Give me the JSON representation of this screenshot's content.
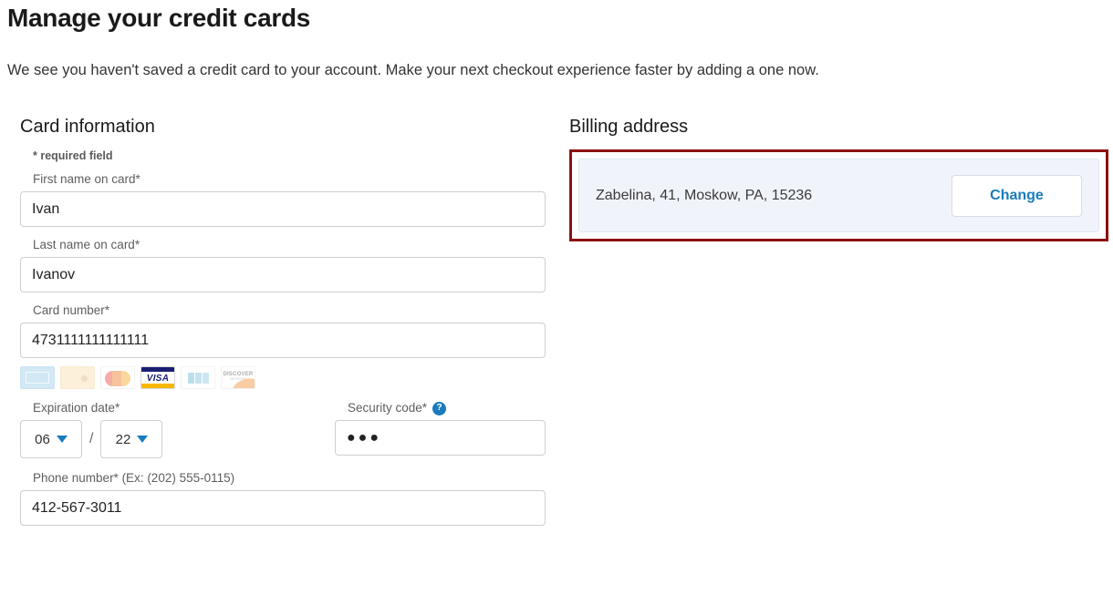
{
  "page": {
    "title": "Manage your credit cards",
    "subtitle": "We see you haven't saved a credit card to your account. Make your next checkout experience faster by adding a one now."
  },
  "card_section": {
    "heading": "Card information",
    "required_note": "* required field",
    "fields": {
      "first_name": {
        "label": "First name on card*",
        "value": "Ivan",
        "placeholder": ""
      },
      "last_name": {
        "label": "Last name on card*",
        "value": "Ivanov",
        "placeholder": ""
      },
      "card_number": {
        "label": "Card number*",
        "value": "4731111111111111",
        "placeholder": ""
      },
      "expiration": {
        "label": "Expiration date*",
        "month": "06",
        "separator": "/",
        "year": "22"
      },
      "security_code": {
        "label": "Security code*",
        "value": "●●●",
        "placeholder": "",
        "help_icon": "question-mark-icon",
        "help_glyph": "?"
      },
      "phone": {
        "label": "Phone number* (Ex: (202) 555-0115)",
        "value": "412-567-3011",
        "placeholder": ""
      }
    },
    "accepted_cards": [
      {
        "name": "amex-card-icon",
        "label": "American Express",
        "active": false
      },
      {
        "name": "diners-card-icon",
        "label": "Diners Club",
        "active": false
      },
      {
        "name": "mastercard-card-icon",
        "label": "Mastercard",
        "active": false
      },
      {
        "name": "visa-card-icon",
        "label": "VISA",
        "active": true
      },
      {
        "name": "jcb-card-icon",
        "label": "JCB",
        "active": false
      },
      {
        "name": "discover-card-icon",
        "label": "DISCOVER",
        "active": false
      }
    ],
    "visa_wordmark": "VISA",
    "discover_wordmark": "DISCOVER",
    "discover_subtext": "NETWORK"
  },
  "billing_section": {
    "heading": "Billing address",
    "address": "Zabelina, 41, Moskow, PA, 15236",
    "change_label": "Change"
  },
  "colors": {
    "accent_blue": "#1a7bbd",
    "highlight_red": "#8c1111",
    "card_background": "#f0f4fa",
    "input_border": "#cfcfcf",
    "label_grey": "#5e5e5e"
  }
}
